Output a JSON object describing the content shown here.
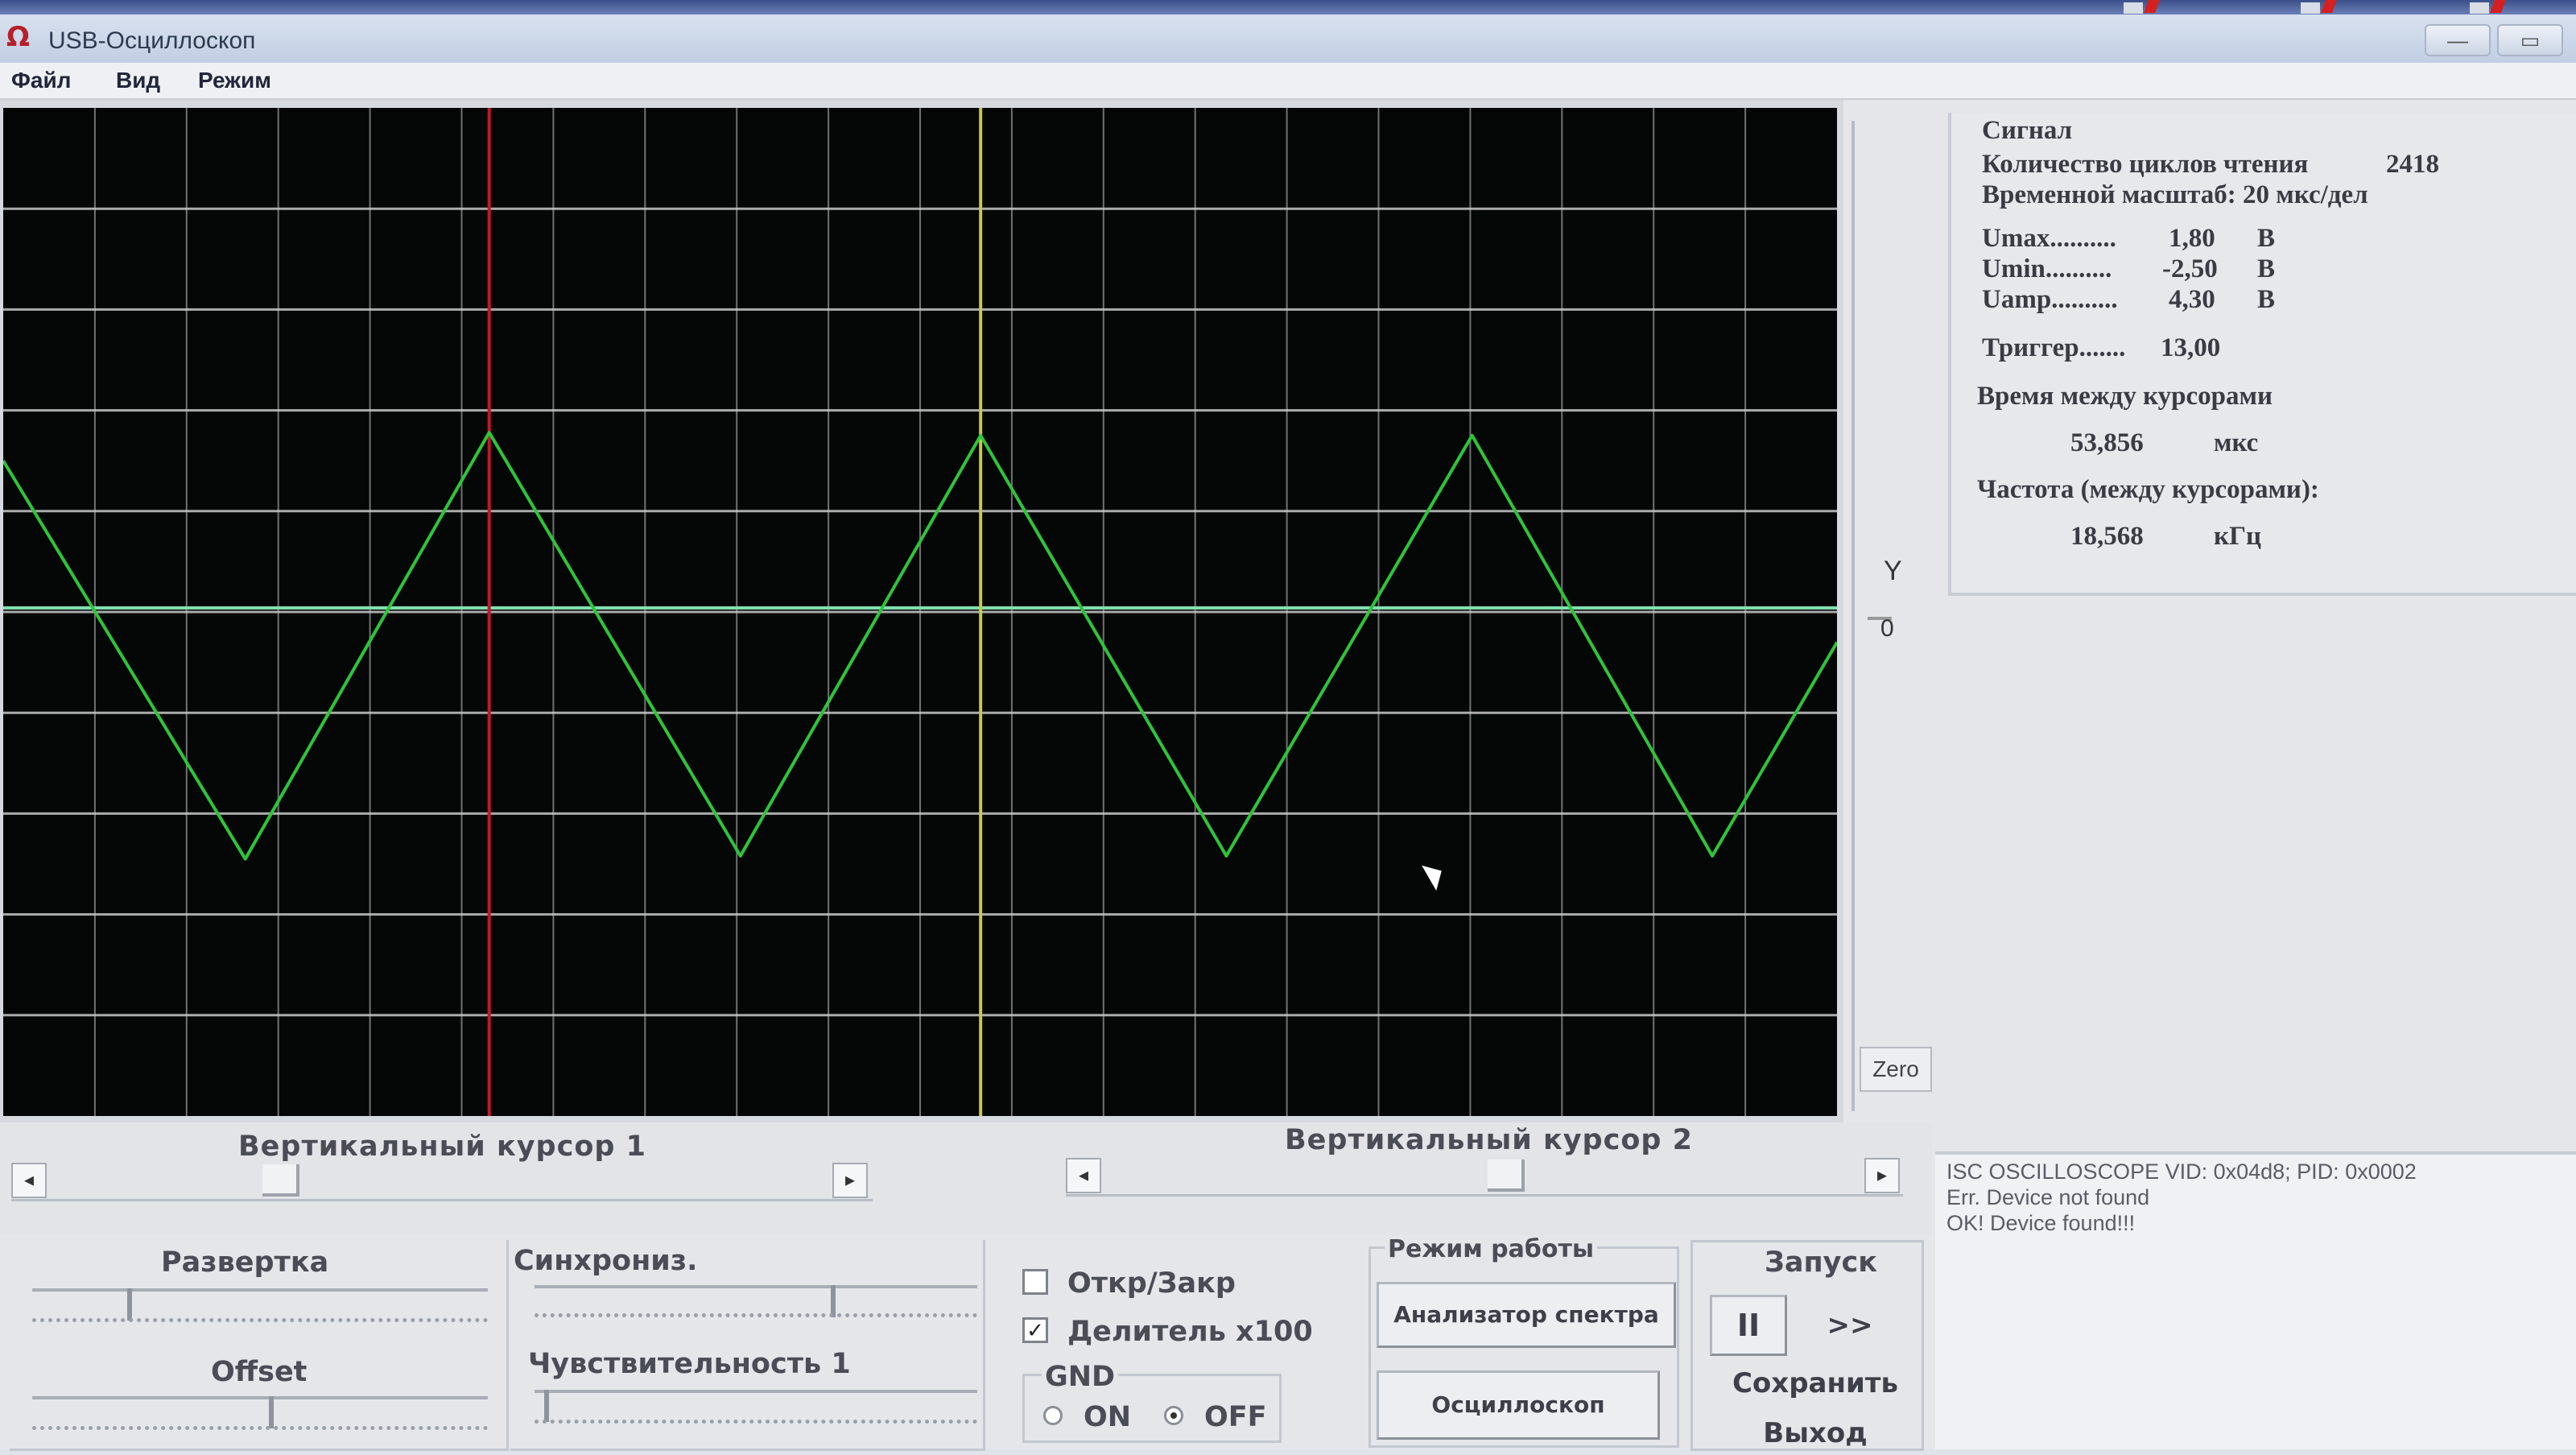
{
  "window": {
    "title": "USB-Осциллоскоп",
    "minimize_glyph": "—",
    "maximize_glyph": "▭"
  },
  "menu": [
    "Файл",
    "Вид",
    "Режим"
  ],
  "scope": {
    "background": "#050707",
    "grid_color": "#c8c8c8",
    "trace_color": "#2fc43a",
    "zero_line_color": "#7fe0b0",
    "cursor1_color": "#c0182a",
    "cursor2_color": "#c8c84a",
    "y_axis_label": "Y",
    "zero_marker": "0",
    "zero_button": "Zero"
  },
  "signal": {
    "group_label": "Сигнал",
    "read_cycles_label": "Количество циклов чтения",
    "read_cycles_value": "2418",
    "time_scale": "Временной масштаб: 20 мкс/дел",
    "umax_label": "Umax..........",
    "umax_value": "1,80",
    "umin_label": "Umin..........",
    "umin_value": "-2,50",
    "uamp_label": "Uamp..........",
    "uamp_value": "4,30",
    "unit_v": "В",
    "trigger_label": "Триггер.......",
    "trigger_value": "13,00",
    "time_between_label": "Время между курсорами",
    "time_between_value": "53,856",
    "time_unit": "мкс",
    "freq_label": "Частота (между курсорами):",
    "freq_value": "18,568",
    "freq_unit": "кГц"
  },
  "log": [
    "ISC OSCILLOSCOPE VID: 0x04d8; PID: 0x0002",
    "Err. Device not found",
    "OK! Device found!!!"
  ],
  "cursors": {
    "cursor1_label": "Вертикальный курсор 1",
    "cursor2_label": "Вертикальный курсор 2",
    "left_arrow": "◂",
    "right_arrow": "▸"
  },
  "controls": {
    "sweep_label": "Развертка",
    "offset_label": "Offset",
    "sync_label": "Синхрониз.",
    "sensitivity_label": "Чувствительность 1",
    "open_close_label": "Откр/Закр",
    "open_close_checked": false,
    "divider_label": "Делитель x100",
    "divider_checked": true,
    "divider_check_glyph": "✓",
    "gnd_label": "GND",
    "gnd_on_label": "ON",
    "gnd_off_label": "OFF",
    "gnd_selected": "OFF",
    "mode_label": "Режим работы",
    "spectrum_button": "Анализатор спектра",
    "scope_button": "Осциллоскоп",
    "run_label": "Запуск",
    "pause_button": "II",
    "forward_button": ">>",
    "save_button": "Сохранить",
    "exit_button": "Выход"
  }
}
